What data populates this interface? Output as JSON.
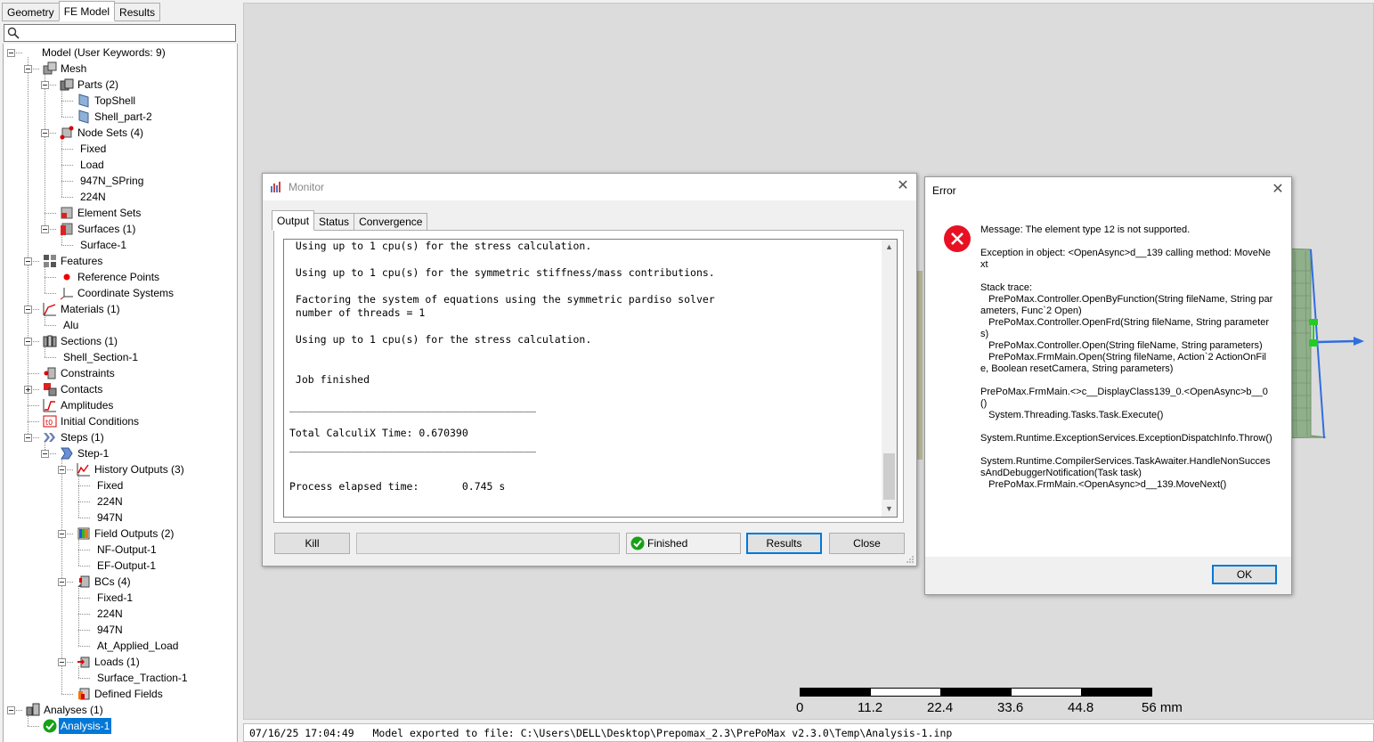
{
  "left_panel": {
    "tabs": [
      "Geometry",
      "FE Model",
      "Results"
    ],
    "active_tab": "FE Model",
    "search": {
      "value": "",
      "placeholder": ""
    },
    "tree": [
      {
        "label": "Model (User Keywords: 9)",
        "level": 0,
        "icon": "model-icon",
        "exp": "minus"
      },
      {
        "label": "Mesh",
        "level": 1,
        "icon": "mesh-icon",
        "exp": "minus"
      },
      {
        "label": "Parts (2)",
        "level": 2,
        "icon": "parts-icon",
        "exp": "minus"
      },
      {
        "label": "TopShell",
        "level": 3,
        "icon": "shell-part-icon"
      },
      {
        "label": "Shell_part-2",
        "level": 3,
        "icon": "shell-part-icon"
      },
      {
        "label": "Node Sets (4)",
        "level": 2,
        "icon": "node-sets-icon",
        "exp": "minus"
      },
      {
        "label": "Fixed",
        "level": 3,
        "icon": ""
      },
      {
        "label": "Load",
        "level": 3,
        "icon": ""
      },
      {
        "label": "947N_SPring",
        "level": 3,
        "icon": ""
      },
      {
        "label": "224N",
        "level": 3,
        "icon": ""
      },
      {
        "label": "Element Sets",
        "level": 2,
        "icon": "element-sets-icon"
      },
      {
        "label": "Surfaces (1)",
        "level": 2,
        "icon": "surfaces-icon",
        "exp": "minus"
      },
      {
        "label": "Surface-1",
        "level": 3,
        "icon": ""
      },
      {
        "label": "Features",
        "level": 1,
        "icon": "features-icon",
        "exp": "minus"
      },
      {
        "label": "Reference Points",
        "level": 2,
        "icon": "reference-point-icon"
      },
      {
        "label": "Coordinate Systems",
        "level": 2,
        "icon": "coordinate-system-icon"
      },
      {
        "label": "Materials (1)",
        "level": 1,
        "icon": "materials-icon",
        "exp": "minus"
      },
      {
        "label": "Alu",
        "level": 2,
        "icon": ""
      },
      {
        "label": "Sections (1)",
        "level": 1,
        "icon": "sections-icon",
        "exp": "minus"
      },
      {
        "label": "Shell_Section-1",
        "level": 2,
        "icon": ""
      },
      {
        "label": "Constraints",
        "level": 1,
        "icon": "constraints-icon"
      },
      {
        "label": "Contacts",
        "level": 1,
        "icon": "contacts-icon",
        "exp": "plus"
      },
      {
        "label": "Amplitudes",
        "level": 1,
        "icon": "amplitudes-icon"
      },
      {
        "label": "Initial Conditions",
        "level": 1,
        "icon": "initial-conditions-icon"
      },
      {
        "label": "Steps (1)",
        "level": 1,
        "icon": "steps-icon",
        "exp": "minus"
      },
      {
        "label": "Step-1",
        "level": 2,
        "icon": "step-icon",
        "exp": "minus"
      },
      {
        "label": "History Outputs (3)",
        "level": 3,
        "icon": "history-outputs-icon",
        "exp": "minus"
      },
      {
        "label": "Fixed",
        "level": 4,
        "icon": ""
      },
      {
        "label": "224N",
        "level": 4,
        "icon": ""
      },
      {
        "label": "947N",
        "level": 4,
        "icon": ""
      },
      {
        "label": "Field Outputs (2)",
        "level": 3,
        "icon": "field-outputs-icon",
        "exp": "minus"
      },
      {
        "label": "NF-Output-1",
        "level": 4,
        "icon": ""
      },
      {
        "label": "EF-Output-1",
        "level": 4,
        "icon": ""
      },
      {
        "label": "BCs (4)",
        "level": 3,
        "icon": "bcs-icon",
        "exp": "minus"
      },
      {
        "label": "Fixed-1",
        "level": 4,
        "icon": ""
      },
      {
        "label": "224N",
        "level": 4,
        "icon": ""
      },
      {
        "label": "947N",
        "level": 4,
        "icon": ""
      },
      {
        "label": "At_Applied_Load",
        "level": 4,
        "icon": ""
      },
      {
        "label": "Loads (1)",
        "level": 3,
        "icon": "loads-icon",
        "exp": "minus"
      },
      {
        "label": "Surface_Traction-1",
        "level": 4,
        "icon": ""
      },
      {
        "label": "Defined Fields",
        "level": 3,
        "icon": "defined-fields-icon"
      },
      {
        "label": "Analyses (1)",
        "level": 0,
        "icon": "analyses-icon",
        "exp": "minus"
      },
      {
        "label": "Analysis-1",
        "level": 1,
        "icon": "analysis-ok-icon",
        "selected": true
      }
    ]
  },
  "monitor": {
    "title": "Monitor",
    "tabs": [
      "Output",
      "Status",
      "Convergence"
    ],
    "active_tab": "Output",
    "output_lines": [
      " Using up to 1 cpu(s) for the stress calculation.",
      "",
      " Using up to 1 cpu(s) for the symmetric stiffness/mass contributions.",
      "",
      " Factoring the system of equations using the symmetric pardiso solver",
      " number of threads = 1",
      "",
      " Using up to 1 cpu(s) for the stress calculation.",
      "",
      "",
      " Job finished",
      "",
      "________________________________________",
      "",
      "Total CalculiX Time: 0.670390",
      "________________________________________",
      "",
      "",
      "Process elapsed time:       0.745 s"
    ],
    "buttons": {
      "kill": "Kill",
      "results": "Results",
      "close": "Close"
    },
    "status_text": "Finished"
  },
  "error_dialog": {
    "title": "Error",
    "paragraphs": [
      "Message: The element type 12 is not supported.",
      "Exception in object: <OpenAsync>d__139 calling method: MoveNext",
      "Stack trace:\n   PrePoMax.Controller.OpenByFunction(String fileName, String parameters, Func`2 Open)\n   PrePoMax.Controller.OpenFrd(String fileName, String parameters)\n   PrePoMax.Controller.Open(String fileName, String parameters)\n   PrePoMax.FrmMain.Open(String fileName, Action`2 ActionOnFile, Boolean resetCamera, String parameters)",
      "PrePoMax.FrmMain.<>c__DisplayClass139_0.<OpenAsync>b__0()\n   System.Threading.Tasks.Task.Execute()",
      "System.Runtime.ExceptionServices.ExceptionDispatchInfo.Throw()",
      "System.Runtime.CompilerServices.TaskAwaiter.HandleNonSuccessAndDebuggerNotification(Task task)\n   PrePoMax.FrmMain.<OpenAsync>d__139.MoveNext()"
    ],
    "ok_label": "OK"
  },
  "viewport": {
    "scale_labels": [
      "0",
      "11.2",
      "22.4",
      "33.6",
      "44.8",
      "56 mm"
    ]
  },
  "status_bar": {
    "text": "07/16/25 17:04:49   Model exported to file: C:\\Users\\DELL\\Desktop\\Prepomax_2.3\\PrePoMax v2.3.0\\Temp\\Analysis-1.inp"
  },
  "colors": {
    "selection": "#0078d7",
    "error_red": "#e81123",
    "ok_green": "#16a116",
    "mesh_green": "#8fb08a",
    "arrow_blue": "#2f6ee0"
  }
}
